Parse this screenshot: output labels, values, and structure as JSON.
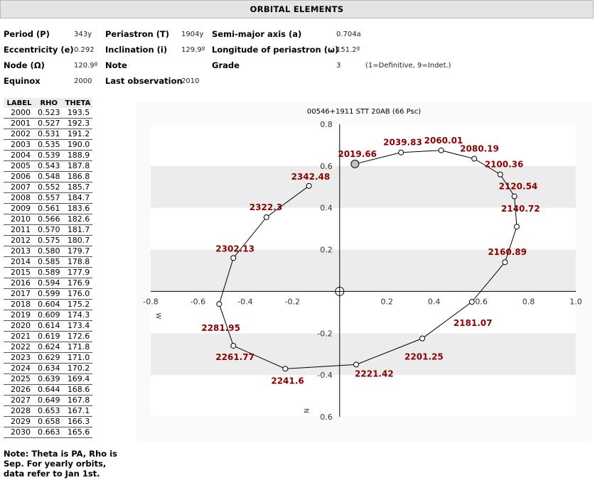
{
  "header": {
    "title": "ORBITAL ELEMENTS"
  },
  "elements": {
    "period_label": "Period (P)",
    "period_value": "343y",
    "periastron_label": "Periastron (T)",
    "periastron_value": "1904y",
    "semimajor_label": "Semi-major axis (a)",
    "semimajor_value": "0.704a",
    "ecc_label": "Eccentricity (e)",
    "ecc_value": "0.292",
    "incl_label": "Inclination (i)",
    "incl_value": "129.9º",
    "longperi_label": "Longitude of periastron (ω)",
    "longperi_value": "151.2º",
    "node_label": "Node (Ω)",
    "node_value": "120.9º",
    "note_label": "Note",
    "grade_label": "Grade",
    "grade_value": "3",
    "grade_desc": "(1=Definitive, 9=Indet.)",
    "equinox_label": "Equinox",
    "equinox_value": "2000",
    "lastobs_label": "Last observation",
    "lastobs_value": "2010"
  },
  "table": {
    "headers": [
      "LABEL",
      "RHO",
      "THETA"
    ],
    "rows": [
      [
        "2000",
        "0.523",
        "193.5"
      ],
      [
        "2001",
        "0.527",
        "192.3"
      ],
      [
        "2002",
        "0.531",
        "191.2"
      ],
      [
        "2003",
        "0.535",
        "190.0"
      ],
      [
        "2004",
        "0.539",
        "188.9"
      ],
      [
        "2005",
        "0.543",
        "187.8"
      ],
      [
        "2006",
        "0.548",
        "186.8"
      ],
      [
        "2007",
        "0.552",
        "185.7"
      ],
      [
        "2008",
        "0.557",
        "184.7"
      ],
      [
        "2009",
        "0.561",
        "183.6"
      ],
      [
        "2010",
        "0.566",
        "182.6"
      ],
      [
        "2011",
        "0.570",
        "181.7"
      ],
      [
        "2012",
        "0.575",
        "180.7"
      ],
      [
        "2013",
        "0.580",
        "179.7"
      ],
      [
        "2014",
        "0.585",
        "178.8"
      ],
      [
        "2015",
        "0.589",
        "177.9"
      ],
      [
        "2016",
        "0.594",
        "176.9"
      ],
      [
        "2017",
        "0.599",
        "176.0"
      ],
      [
        "2018",
        "0.604",
        "175.2"
      ],
      [
        "2019",
        "0.609",
        "174.3"
      ],
      [
        "2020",
        "0.614",
        "173.4"
      ],
      [
        "2021",
        "0.619",
        "172.6"
      ],
      [
        "2022",
        "0.624",
        "171.8"
      ],
      [
        "2023",
        "0.629",
        "171.0"
      ],
      [
        "2024",
        "0.634",
        "170.2"
      ],
      [
        "2025",
        "0.639",
        "169.4"
      ],
      [
        "2026",
        "0.644",
        "168.6"
      ],
      [
        "2027",
        "0.649",
        "167.8"
      ],
      [
        "2028",
        "0.653",
        "167.1"
      ],
      [
        "2029",
        "0.658",
        "166.3"
      ],
      [
        "2030",
        "0.663",
        "165.6"
      ]
    ]
  },
  "note_text": "Note: Theta is PA, Rho is Sep. For yearly orbits, data refer to Jan 1st.",
  "chart_data": {
    "type": "line",
    "title": "00546+1911 STT  20AB (66 Psc)",
    "xlim": [
      -0.8,
      1.0
    ],
    "ylim": [
      -0.6,
      0.8
    ],
    "xticks": [
      -0.8,
      -0.6,
      -0.4,
      -0.2,
      0.2,
      0.4,
      0.6,
      0.8,
      1.0
    ],
    "xtick_labels": [
      "-0.8",
      "-0.6",
      "-0.4",
      "-0.2",
      "0.2",
      "0.4",
      "0.6",
      "0.8",
      "1.0"
    ],
    "yticks": [
      0.8,
      0.6,
      0.4,
      0.2,
      -0.2,
      -0.4,
      -0.6
    ],
    "ytick_labels": [
      "0.8",
      "0.6",
      "0.4",
      "0.2",
      "-0.2",
      "-0.4",
      "0.6"
    ],
    "bands": [
      [
        0.4,
        0.6
      ],
      [
        0.0,
        0.2
      ],
      [
        -0.4,
        -0.2
      ]
    ],
    "axis_w_label": "W",
    "axis_n_label": "N",
    "band_color": "#ececec",
    "label_color": "#8b0000",
    "current_marker_color": "#c0c0c0",
    "points": [
      {
        "label": "2019.66",
        "x": 0.065,
        "y": 0.61,
        "current": true
      },
      {
        "label": "2039.83",
        "x": 0.26,
        "y": 0.665
      },
      {
        "label": "2060.01",
        "x": 0.43,
        "y": 0.675
      },
      {
        "label": "2080.19",
        "x": 0.57,
        "y": 0.635
      },
      {
        "label": "2100.36",
        "x": 0.68,
        "y": 0.56
      },
      {
        "label": "2120.54",
        "x": 0.74,
        "y": 0.455
      },
      {
        "label": "2140.72",
        "x": 0.75,
        "y": 0.31
      },
      {
        "label": "2160.89",
        "x": 0.7,
        "y": 0.14
      },
      {
        "label": "2181.07",
        "x": 0.56,
        "y": -0.05
      },
      {
        "label": "2201.25",
        "x": 0.35,
        "y": -0.225
      },
      {
        "label": "2221.42",
        "x": 0.07,
        "y": -0.35
      },
      {
        "label": "2241.6",
        "x": -0.23,
        "y": -0.37
      },
      {
        "label": "2261.77",
        "x": -0.45,
        "y": -0.26
      },
      {
        "label": "2281.95",
        "x": -0.51,
        "y": -0.06
      },
      {
        "label": "2302.13",
        "x": -0.45,
        "y": 0.16
      },
      {
        "label": "2322.3",
        "x": -0.31,
        "y": 0.355
      },
      {
        "label": "2342.48",
        "x": -0.13,
        "y": 0.505
      }
    ]
  }
}
